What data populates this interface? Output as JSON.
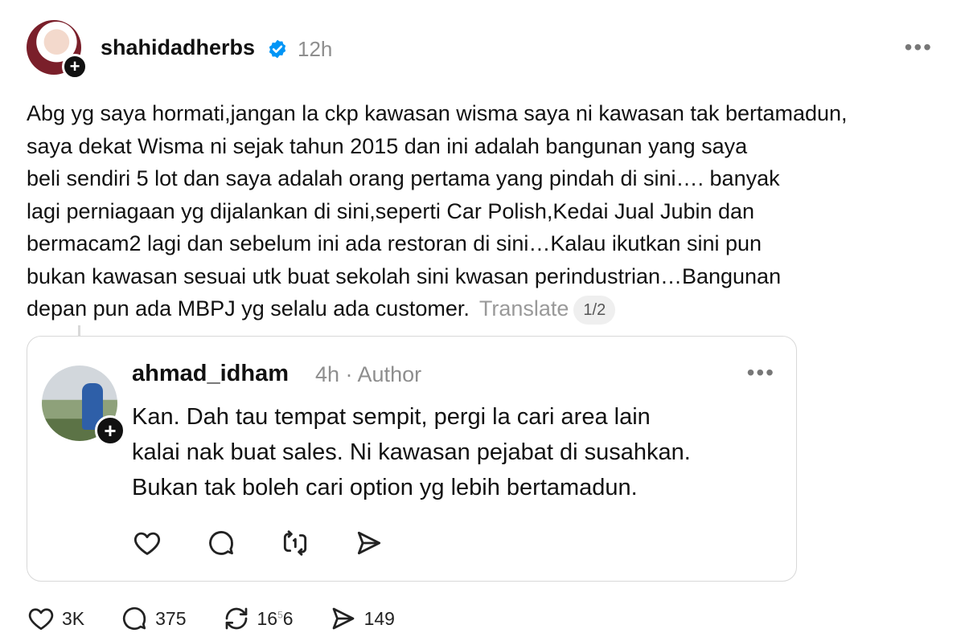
{
  "post": {
    "username": "shahidadherbs",
    "time": "12h",
    "more_label": "•••",
    "plus_label": "+",
    "body_lines": [
      "Abg yg saya hormati,jangan la ckp kawasan wisma saya ni kawasan tak bertamadun,",
      "saya dekat Wisma ni sejak tahun 2015 dan ini adalah bangunan yang saya",
      "beli sendiri 5 lot dan saya adalah orang pertama yang pindah di sini…. banyak",
      "lagi perniagaan yg dijalankan di sini,seperti Car Polish,Kedai Jual Jubin dan",
      "bermacam2 lagi dan sebelum ini ada restoran di sini…Kalau ikutkan sini pun",
      "bukan kawasan sesuai utk buat sekolah sini kwasan perindustrian…Bangunan",
      "depan pun ada MBPJ yg selalu ada customer."
    ],
    "translate_label": "Translate",
    "page_indicator": "1/2"
  },
  "reply": {
    "username": "ahmad_idham",
    "time_author": "4h · Author",
    "more_label": "•••",
    "plus_label": "+",
    "lines": [
      "Kan.  Dah tau tempat sempit, pergi la cari area lain",
      "kalai nak buat sales. Ni kawasan pejabat di susahkan.",
      "Bukan tak boleh cari option yg lebih bertamadun."
    ],
    "actions": [
      "heart-icon",
      "comment-icon",
      "repost-icon",
      "share-icon"
    ]
  },
  "stats": {
    "likes": "3K",
    "comments": "375",
    "reposts": "16",
    "reposts_sup_top": "5",
    "reposts_sup_bottom": "6",
    "shares": "149"
  },
  "colors": {
    "text": "#111111",
    "muted": "#8e8e8e",
    "verified": "#0095f6",
    "border": "#d8d8d8"
  }
}
